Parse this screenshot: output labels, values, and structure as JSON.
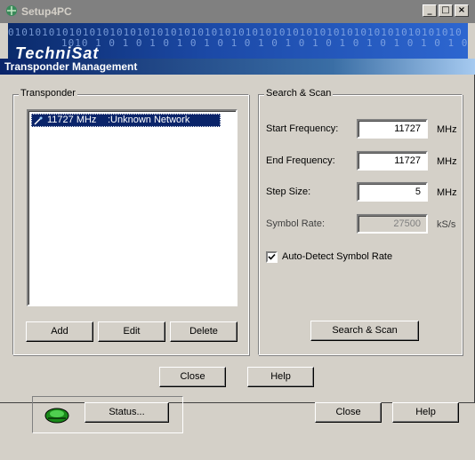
{
  "parent_window": {
    "title": "Setup4PC",
    "controls": {
      "minimize": "_",
      "maximize": "□",
      "close": "×"
    },
    "banner": {
      "binary_line1": "0101010101010101010101010101010101010101010101010101010101010101010",
      "binary_line2": "1010 1 0 1 0 1 0 1 0 1 0 1 0 1 0 1 0 1 0 1 0 1 0 1 0 1 0 1 0 1 0 1 0",
      "logo_text": "TechniSat"
    },
    "buttons": {
      "status": "Status...",
      "close": "Close",
      "help": "Help"
    }
  },
  "dialog": {
    "title": "Transponder Management",
    "transponder_group": {
      "label": "Transponder",
      "list": [
        {
          "frequency": "11727 MHz",
          "network": ":Unknown Network",
          "selected": true
        }
      ],
      "buttons": {
        "add": "Add",
        "edit": "Edit",
        "delete": "Delete"
      }
    },
    "search_group": {
      "label": "Search & Scan",
      "start_frequency": {
        "label": "Start Frequency:",
        "value": "11727",
        "unit": "MHz"
      },
      "end_frequency": {
        "label": "End Frequency:",
        "value": "11727",
        "unit": "MHz"
      },
      "step_size": {
        "label": "Step Size:",
        "value": "5",
        "unit": "MHz"
      },
      "symbol_rate": {
        "label": "Symbol Rate:",
        "value": "27500",
        "unit": "kS/s",
        "disabled": true
      },
      "auto_detect": {
        "label": "Auto-Detect Symbol Rate",
        "checked": true
      },
      "search_button": "Search & Scan"
    },
    "buttons": {
      "close": "Close",
      "help": "Help"
    }
  },
  "colors": {
    "dialog_title_start": "#0a246a",
    "dialog_title_end": "#a6caf0",
    "face": "#d4d0c8",
    "selection": "#0a246a"
  }
}
